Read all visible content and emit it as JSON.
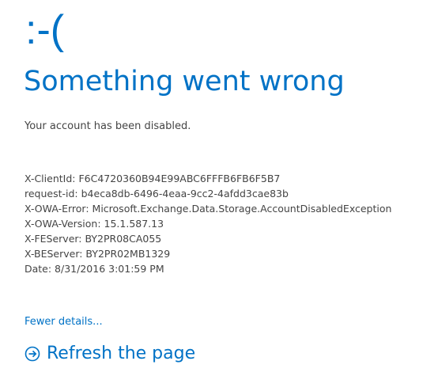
{
  "error": {
    "emoticon": ":-(",
    "title": "Something went wrong",
    "message": "Your account has been disabled."
  },
  "details": [
    "X-ClientId: F6C4720360B94E99ABC6FFFB6FB6F5B7",
    "request-id: b4eca8db-6496-4eaa-9cc2-4afdd3cae83b",
    "X-OWA-Error: Microsoft.Exchange.Data.Storage.AccountDisabledException",
    "X-OWA-Version: 15.1.587.13",
    "X-FEServer: BY2PR08CA055",
    "X-BEServer: BY2PR02MB1329",
    "Date: 8/31/2016 3:01:59 PM"
  ],
  "links": {
    "fewer_details": "Fewer details...",
    "refresh": "Refresh the page",
    "refresh_icon": "arrow-circle-right-icon"
  },
  "colors": {
    "accent": "#0072c6",
    "body_text": "#444444",
    "background": "#ffffff"
  }
}
